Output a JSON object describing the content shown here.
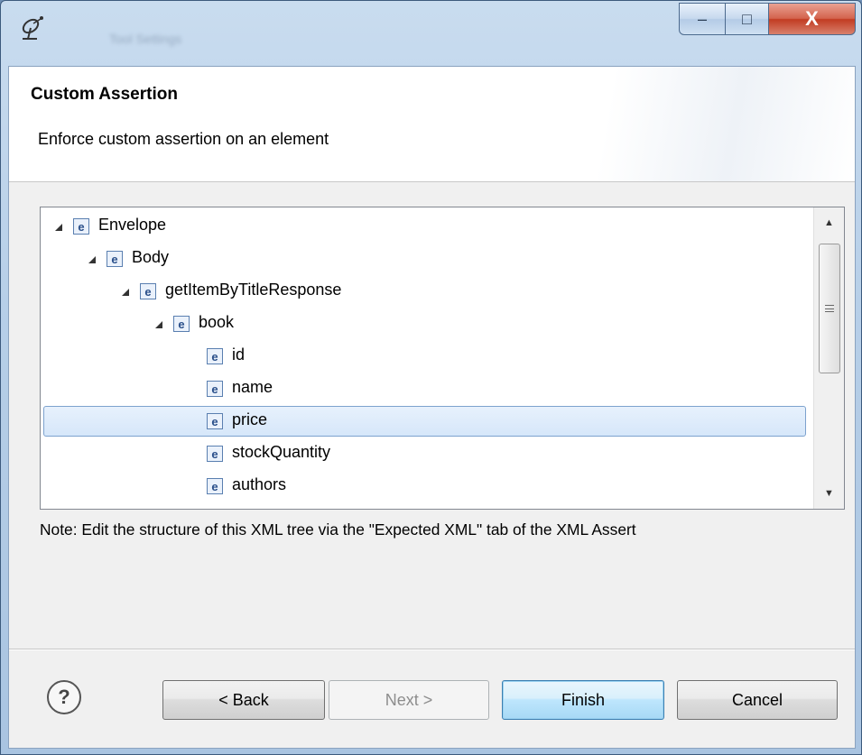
{
  "window": {
    "title": "Tool Settings",
    "controls": {
      "minimize": "–",
      "maximize": "□",
      "close": "X"
    }
  },
  "header": {
    "title": "Custom Assertion",
    "description": "Enforce custom assertion on an element"
  },
  "tree": {
    "icon_glyph": "e",
    "nodes": [
      {
        "label": "Envelope",
        "level": 0,
        "expanded": true
      },
      {
        "label": "Body",
        "level": 1,
        "expanded": true
      },
      {
        "label": "getItemByTitleResponse",
        "level": 2,
        "expanded": true
      },
      {
        "label": "book",
        "level": 3,
        "expanded": true
      },
      {
        "label": "id",
        "level": 4
      },
      {
        "label": "name",
        "level": 4
      },
      {
        "label": "price",
        "level": 4,
        "selected": true
      },
      {
        "label": "stockQuantity",
        "level": 4
      },
      {
        "label": "authors",
        "level": 4
      }
    ]
  },
  "note": "Note: Edit the structure of this XML tree via the \"Expected XML\" tab of the XML Assert",
  "buttons": {
    "help": "?",
    "back": "< Back",
    "next": "Next >",
    "finish": "Finish",
    "cancel": "Cancel"
  }
}
